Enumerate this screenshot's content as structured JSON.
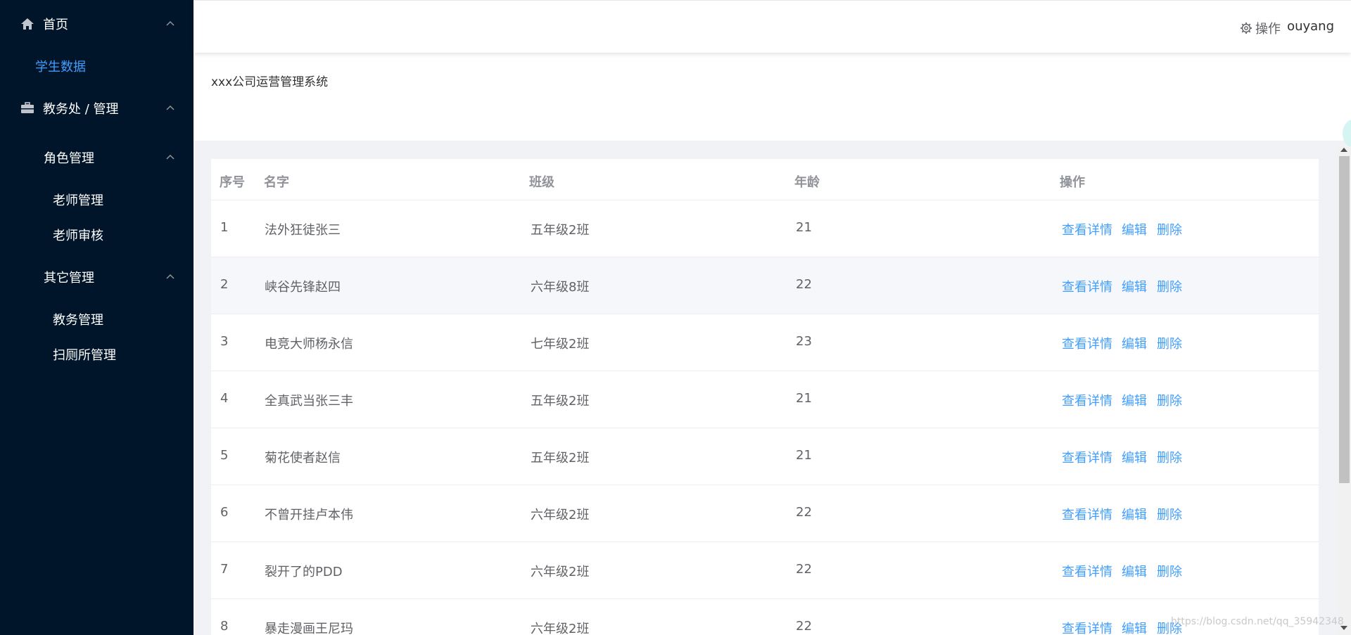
{
  "sidebar": {
    "items": [
      {
        "label": "首页"
      },
      {
        "label": "学生数据"
      },
      {
        "label": "教务处 / 管理"
      },
      {
        "label": "角色管理"
      },
      {
        "label": "老师管理"
      },
      {
        "label": "老师审核"
      },
      {
        "label": "其它管理"
      },
      {
        "label": "教务管理"
      },
      {
        "label": "扫厕所管理"
      }
    ]
  },
  "header": {
    "ops_label": "操作",
    "user": "ouyang"
  },
  "system_title": "xxx公司运营管理系统",
  "table": {
    "columns": [
      "序号",
      "名字",
      "班级",
      "年龄",
      "操作"
    ],
    "actions": [
      "查看详情",
      "编辑",
      "删除"
    ],
    "rows": [
      {
        "no": "1",
        "name": "法外狂徒张三",
        "class": "五年级2班",
        "age": "21"
      },
      {
        "no": "2",
        "name": "峡谷先锋赵四",
        "class": "六年级8班",
        "age": "22"
      },
      {
        "no": "3",
        "name": "电竞大师杨永信",
        "class": "七年级2班",
        "age": "23"
      },
      {
        "no": "4",
        "name": "全真武当张三丰",
        "class": "五年级2班",
        "age": "21"
      },
      {
        "no": "5",
        "name": "菊花使者赵信",
        "class": "五年级2班",
        "age": "21"
      },
      {
        "no": "6",
        "name": "不曾开挂卢本伟",
        "class": "六年级2班",
        "age": "22"
      },
      {
        "no": "7",
        "name": "裂开了的PDD",
        "class": "六年级2班",
        "age": "22"
      },
      {
        "no": "8",
        "name": "暴走漫画王尼玛",
        "class": "六年级2班",
        "age": "22"
      }
    ]
  },
  "watermark": "https://blog.csdn.net/qq_35942348",
  "colors": {
    "sidebar_bg": "#001529",
    "accent": "#409eff",
    "content_bg": "#f0f2f5",
    "row_hover": "#f5f7fa"
  },
  "icons": {
    "home": "home-icon",
    "menu": "briefcase-icon",
    "settings": "gear-icon",
    "chevron": "chevron-up-icon"
  }
}
